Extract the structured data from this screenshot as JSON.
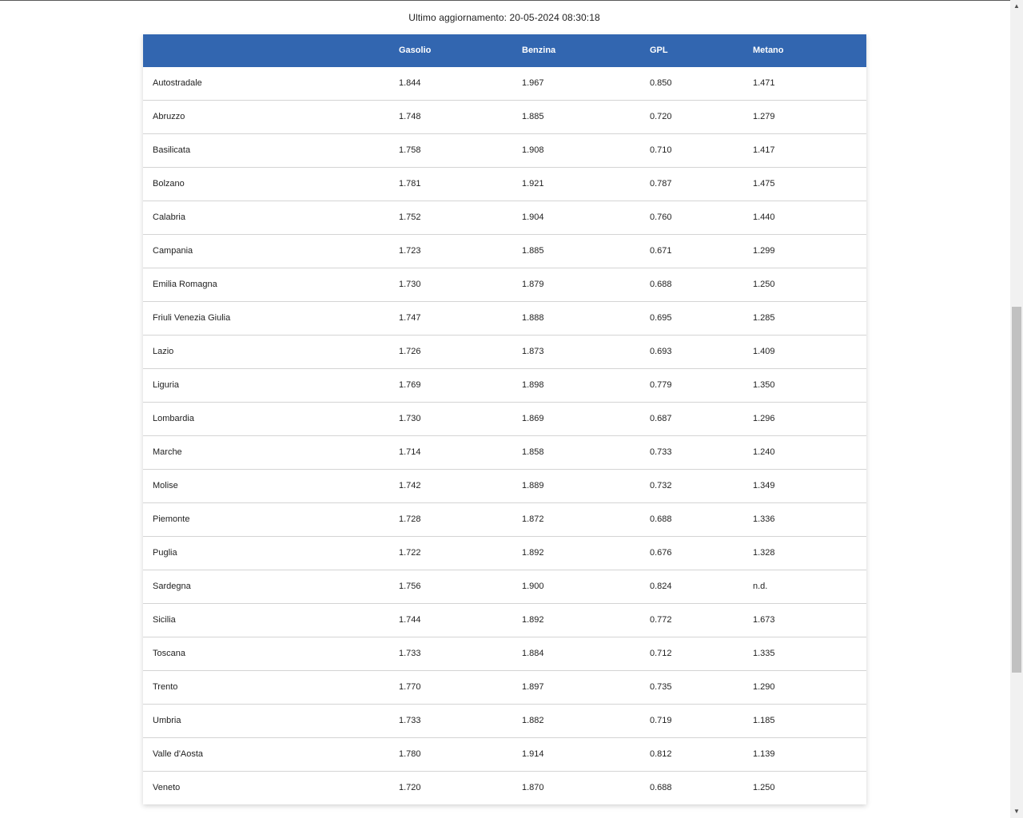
{
  "page": {
    "last_update": "Ultimo aggiornamento: 20-05-2024 08:30:18"
  },
  "table": {
    "headers": [
      "",
      "Gasolio",
      "Benzina",
      "GPL",
      "Metano"
    ],
    "rows": [
      [
        "Autostradale",
        "1.844",
        "1.967",
        "0.850",
        "1.471"
      ],
      [
        "Abruzzo",
        "1.748",
        "1.885",
        "0.720",
        "1.279"
      ],
      [
        "Basilicata",
        "1.758",
        "1.908",
        "0.710",
        "1.417"
      ],
      [
        "Bolzano",
        "1.781",
        "1.921",
        "0.787",
        "1.475"
      ],
      [
        "Calabria",
        "1.752",
        "1.904",
        "0.760",
        "1.440"
      ],
      [
        "Campania",
        "1.723",
        "1.885",
        "0.671",
        "1.299"
      ],
      [
        "Emilia Romagna",
        "1.730",
        "1.879",
        "0.688",
        "1.250"
      ],
      [
        "Friuli Venezia Giulia",
        "1.747",
        "1.888",
        "0.695",
        "1.285"
      ],
      [
        "Lazio",
        "1.726",
        "1.873",
        "0.693",
        "1.409"
      ],
      [
        "Liguria",
        "1.769",
        "1.898",
        "0.779",
        "1.350"
      ],
      [
        "Lombardia",
        "1.730",
        "1.869",
        "0.687",
        "1.296"
      ],
      [
        "Marche",
        "1.714",
        "1.858",
        "0.733",
        "1.240"
      ],
      [
        "Molise",
        "1.742",
        "1.889",
        "0.732",
        "1.349"
      ],
      [
        "Piemonte",
        "1.728",
        "1.872",
        "0.688",
        "1.336"
      ],
      [
        "Puglia",
        "1.722",
        "1.892",
        "0.676",
        "1.328"
      ],
      [
        "Sardegna",
        "1.756",
        "1.900",
        "0.824",
        "n.d."
      ],
      [
        "Sicilia",
        "1.744",
        "1.892",
        "0.772",
        "1.673"
      ],
      [
        "Toscana",
        "1.733",
        "1.884",
        "0.712",
        "1.335"
      ],
      [
        "Trento",
        "1.770",
        "1.897",
        "0.735",
        "1.290"
      ],
      [
        "Umbria",
        "1.733",
        "1.882",
        "0.719",
        "1.185"
      ],
      [
        "Valle d'Aosta",
        "1.780",
        "1.914",
        "0.812",
        "1.139"
      ],
      [
        "Veneto",
        "1.720",
        "1.870",
        "0.688",
        "1.250"
      ]
    ]
  },
  "scrollbar": {
    "up_icon": "triangle-up-icon",
    "down_icon": "triangle-down-icon"
  },
  "colors": {
    "header_bg": "#3266b0",
    "header_text": "#ffffff",
    "row_divider": "#d4d4d4"
  }
}
